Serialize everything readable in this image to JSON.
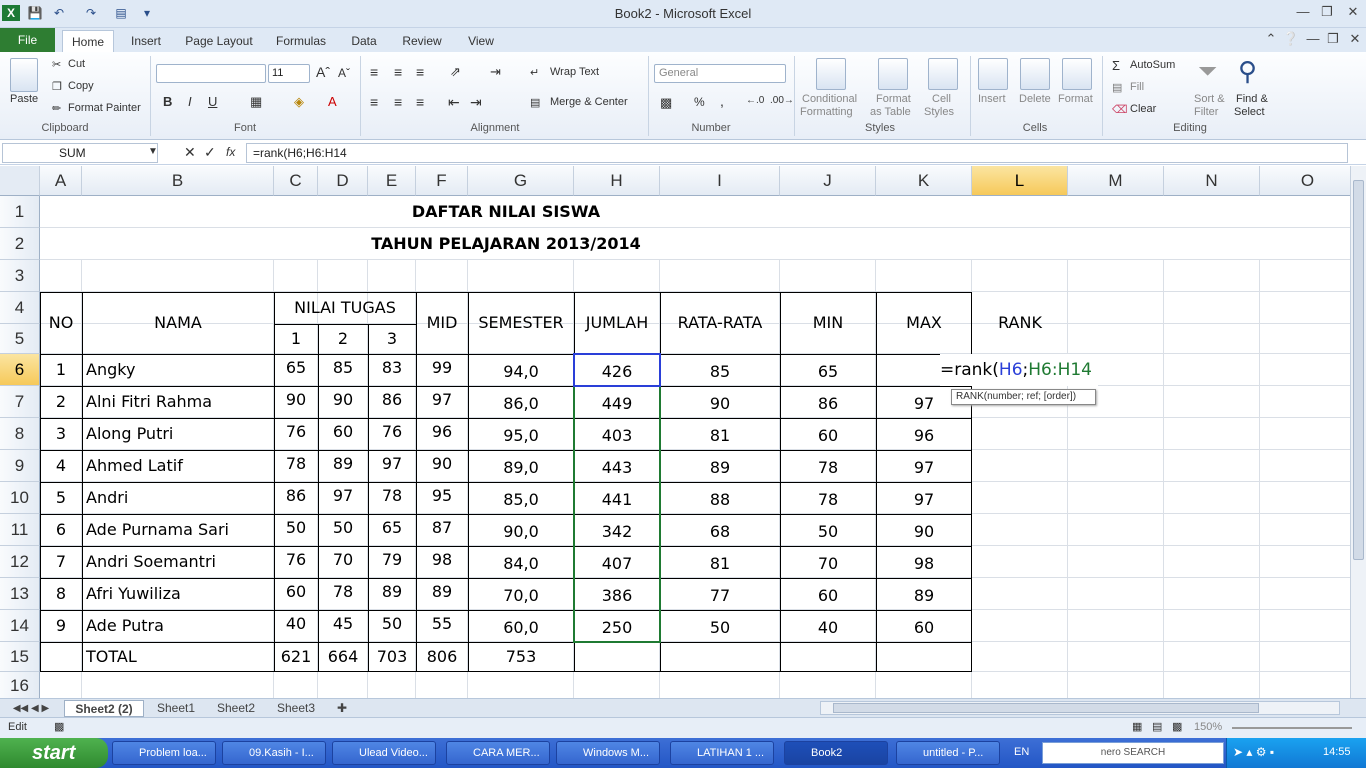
{
  "titlebar": {
    "title": "Book2  -  Microsoft Excel"
  },
  "ribbon_tabs": [
    "Home",
    "Insert",
    "Page Layout",
    "Formulas",
    "Data",
    "Review",
    "View"
  ],
  "file_tab": "File",
  "clipboard": {
    "paste": "Paste",
    "cut": "Cut",
    "copy": "Copy",
    "format_painter": "Format Painter",
    "group": "Clipboard"
  },
  "font": {
    "size": "11",
    "group": "Font",
    "bold": "B",
    "italic": "I",
    "underline": "U"
  },
  "alignment": {
    "wrap": "Wrap Text",
    "merge": "Merge & Center",
    "group": "Alignment"
  },
  "number": {
    "format": "General",
    "percent": "%",
    "comma": ",",
    "group": "Number"
  },
  "styles": {
    "conditional": "Conditional",
    "conditional2": "Formatting",
    "format_table": "Format",
    "format_table2": "as Table",
    "cell_styles": "Cell",
    "cell_styles2": "Styles",
    "group": "Styles"
  },
  "cells": {
    "insert": "Insert",
    "delete": "Delete",
    "format": "Format",
    "group": "Cells"
  },
  "editing": {
    "autosum": "AutoSum",
    "fill": "Fill",
    "clear": "Clear",
    "sort": "Sort &",
    "sort2": "Filter",
    "find": "Find &",
    "find2": "Select",
    "group": "Editing"
  },
  "formula_bar": {
    "name_box": "SUM",
    "fx": "fx",
    "formula": "=rank(H6;H6:H14"
  },
  "columns": [
    "A",
    "B",
    "C",
    "D",
    "E",
    "F",
    "G",
    "H",
    "I",
    "J",
    "K",
    "L",
    "M",
    "N",
    "O"
  ],
  "rows": [
    "1",
    "2",
    "3",
    "4",
    "5",
    "6",
    "7",
    "8",
    "9",
    "10",
    "11",
    "12",
    "13",
    "14",
    "15",
    "16"
  ],
  "sheet": {
    "title1": "DAFTAR NILAI SISWA",
    "title2": "TAHUN PELAJARAN 2013/2014",
    "headers": {
      "no": "NO",
      "nama": "NAMA",
      "nilai_tugas": "NILAI TUGAS",
      "t1": "1",
      "t2": "2",
      "t3": "3",
      "mid": "MID",
      "semester": "SEMESTER",
      "jumlah": "JUMLAH",
      "rata": "RATA-RATA",
      "min": "MIN",
      "max": "MAX",
      "rank": "RANK"
    },
    "rows": [
      {
        "no": "1",
        "nama": "Angky",
        "t1": "65",
        "t2": "85",
        "t3": "83",
        "mid": "99",
        "sem": "94,0",
        "jml": "426",
        "rata": "85",
        "min": "65",
        "max": ""
      },
      {
        "no": "2",
        "nama": "Alni Fitri Rahma",
        "t1": "90",
        "t2": "90",
        "t3": "86",
        "mid": "97",
        "sem": "86,0",
        "jml": "449",
        "rata": "90",
        "min": "86",
        "max": "97"
      },
      {
        "no": "3",
        "nama": "Along Putri",
        "t1": "76",
        "t2": "60",
        "t3": "76",
        "mid": "96",
        "sem": "95,0",
        "jml": "403",
        "rata": "81",
        "min": "60",
        "max": "96"
      },
      {
        "no": "4",
        "nama": "Ahmed Latif",
        "t1": "78",
        "t2": "89",
        "t3": "97",
        "mid": "90",
        "sem": "89,0",
        "jml": "443",
        "rata": "89",
        "min": "78",
        "max": "97"
      },
      {
        "no": "5",
        "nama": "Andri",
        "t1": "86",
        "t2": "97",
        "t3": "78",
        "mid": "95",
        "sem": "85,0",
        "jml": "441",
        "rata": "88",
        "min": "78",
        "max": "97"
      },
      {
        "no": "6",
        "nama": "Ade Purnama Sari",
        "t1": "50",
        "t2": "50",
        "t3": "65",
        "mid": "87",
        "sem": "90,0",
        "jml": "342",
        "rata": "68",
        "min": "50",
        "max": "90"
      },
      {
        "no": "7",
        "nama": "Andri Soemantri",
        "t1": "76",
        "t2": "70",
        "t3": "79",
        "mid": "98",
        "sem": "84,0",
        "jml": "407",
        "rata": "81",
        "min": "70",
        "max": "98"
      },
      {
        "no": "8",
        "nama": "Afri Yuwiliza",
        "t1": "60",
        "t2": "78",
        "t3": "89",
        "mid": "89",
        "sem": "70,0",
        "jml": "386",
        "rata": "77",
        "min": "60",
        "max": "89"
      },
      {
        "no": "9",
        "nama": "Ade Putra",
        "t1": "40",
        "t2": "45",
        "t3": "50",
        "mid": "55",
        "sem": "60,0",
        "jml": "250",
        "rata": "50",
        "min": "40",
        "max": "60"
      }
    ],
    "total": {
      "label": "TOTAL",
      "t1": "621",
      "t2": "664",
      "t3": "703",
      "mid": "806",
      "sem": "753"
    },
    "edit": {
      "prefix": "=rank(",
      "ref1": "H6",
      ";": ";",
      "ref2": "H6:H14"
    },
    "tooltip": "RANK(number; ref; [order])"
  },
  "sheet_tabs": [
    "Sheet2 (2)",
    "Sheet1",
    "Sheet2",
    "Sheet3"
  ],
  "status": {
    "mode": "Edit",
    "zoom": "150%"
  },
  "taskbar": {
    "start": "start",
    "items": [
      "Problem loa...",
      "09.Kasih - I...",
      "Ulead Video...",
      "CARA MER...",
      "Windows M...",
      "LATIHAN 1 ...",
      "Book2",
      "untitled - P..."
    ],
    "lang": "EN",
    "search": "nero SEARCH",
    "clock": "14:55"
  }
}
